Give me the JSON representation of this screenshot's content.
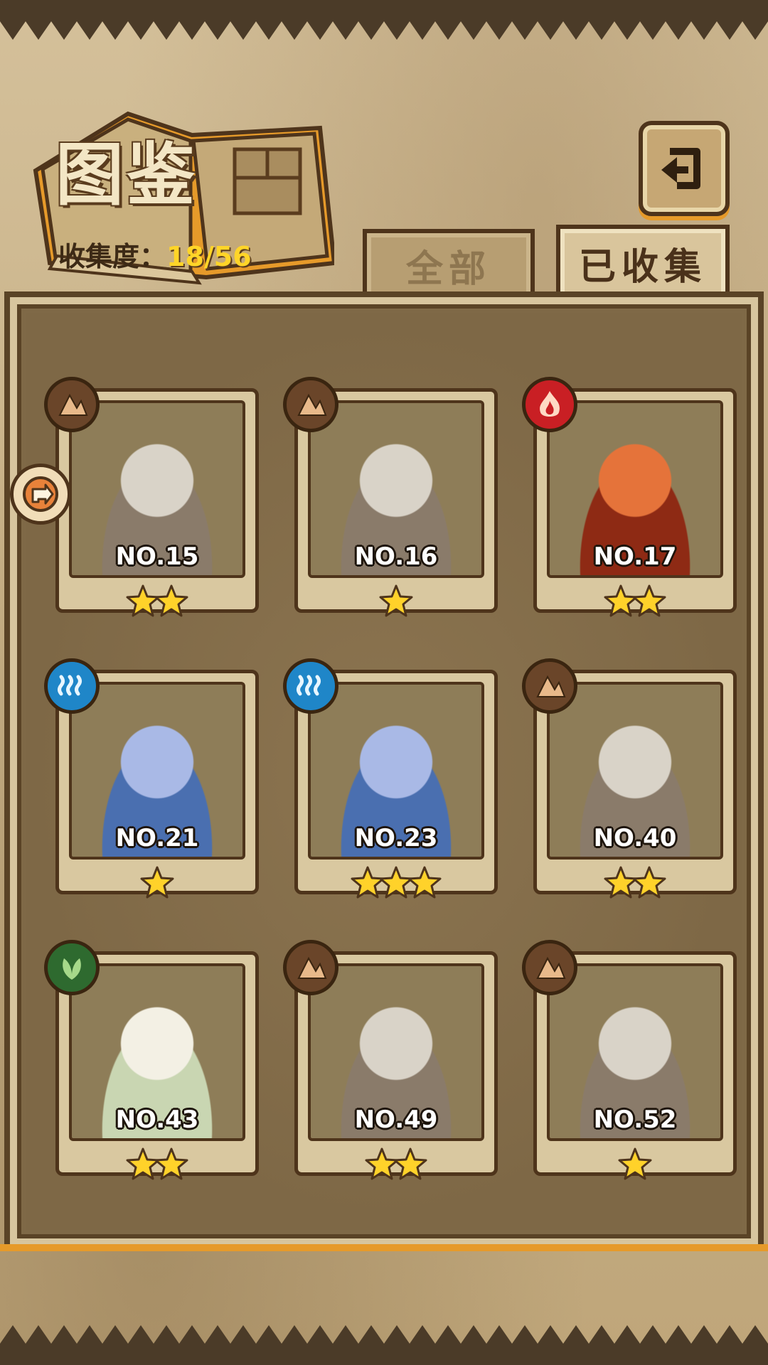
{
  "header": {
    "title": "图鉴",
    "collection_label": "收集度：",
    "collection_value": "18/56"
  },
  "tabs": [
    {
      "label": "全部",
      "active": false
    },
    {
      "label": "已收集",
      "active": true
    }
  ],
  "colors": {
    "earth": "#6a4529",
    "fire": "#c91f24",
    "water": "#1f86c8",
    "grass": "#2e6a2f",
    "star": "#ffd22a",
    "accent": "#e69a2a"
  },
  "cards": [
    {
      "number": "NO.15",
      "element": "earth",
      "stars": 2
    },
    {
      "number": "NO.16",
      "element": "earth",
      "stars": 1
    },
    {
      "number": "NO.17",
      "element": "fire",
      "stars": 2
    },
    {
      "number": "NO.21",
      "element": "water",
      "stars": 1
    },
    {
      "number": "NO.23",
      "element": "water",
      "stars": 3
    },
    {
      "number": "NO.40",
      "element": "earth",
      "stars": 2
    },
    {
      "number": "NO.43",
      "element": "grass",
      "stars": 2
    },
    {
      "number": "NO.49",
      "element": "earth",
      "stars": 2
    },
    {
      "number": "NO.52",
      "element": "earth",
      "stars": 1
    }
  ]
}
